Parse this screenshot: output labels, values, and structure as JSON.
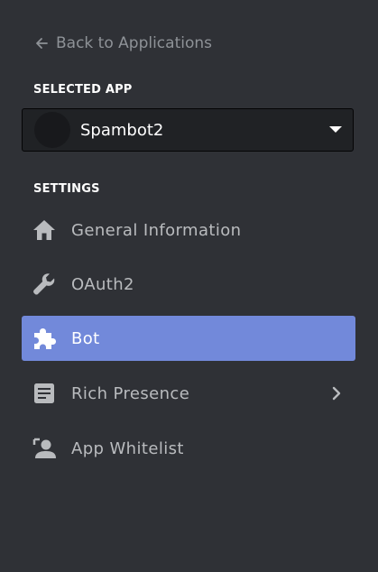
{
  "back_link": {
    "label": "Back to Applications",
    "icon": "arrow-left-icon"
  },
  "selected_app": {
    "section_label": "SELECTED APP",
    "name": "Spambot2",
    "dropdown_icon": "caret-down-icon"
  },
  "settings": {
    "section_label": "SETTINGS",
    "items": [
      {
        "label": "General Information",
        "icon": "home-icon",
        "active": false
      },
      {
        "label": "OAuth2",
        "icon": "wrench-icon",
        "active": false
      },
      {
        "label": "Bot",
        "icon": "puzzle-piece-icon",
        "active": true
      },
      {
        "label": "Rich Presence",
        "icon": "document-icon",
        "active": false,
        "has_submenu": true
      },
      {
        "label": "App Whitelist",
        "icon": "user-whitelist-icon",
        "active": false
      }
    ]
  },
  "colors": {
    "background": "#2f3136",
    "active_item": "#7289da",
    "muted_text": "#8e9297",
    "item_text": "#b9bbbe",
    "select_bg": "#202225"
  }
}
